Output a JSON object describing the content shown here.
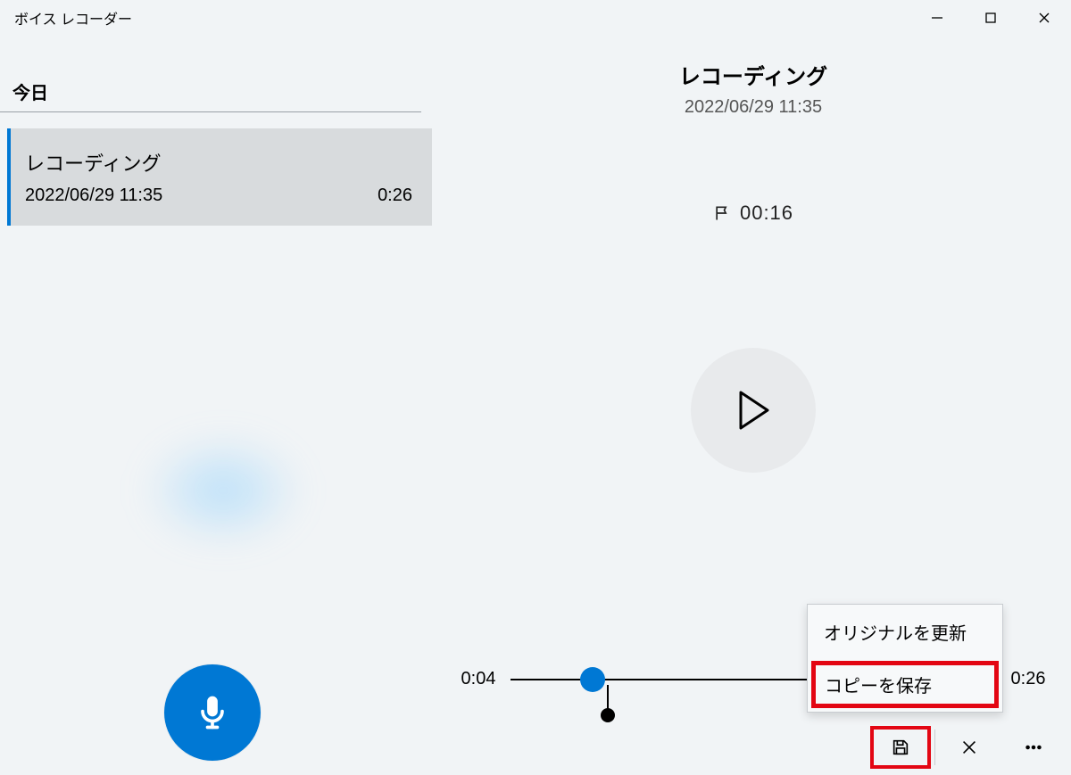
{
  "app": {
    "title": "ボイス レコーダー"
  },
  "left": {
    "section_label": "今日",
    "recordings": [
      {
        "name": "レコーディング",
        "date": "2022/06/29 11:35",
        "duration": "0:26"
      }
    ]
  },
  "detail": {
    "title": "レコーディング",
    "date": "2022/06/29 11:35",
    "flag_time": "00:16"
  },
  "timeline": {
    "current": "0:04",
    "end": "0:26",
    "thumb_percent": 17,
    "marker_percent": 20
  },
  "popup": {
    "item_update": "オリジナルを更新",
    "item_save_copy": "コピーを保存"
  }
}
